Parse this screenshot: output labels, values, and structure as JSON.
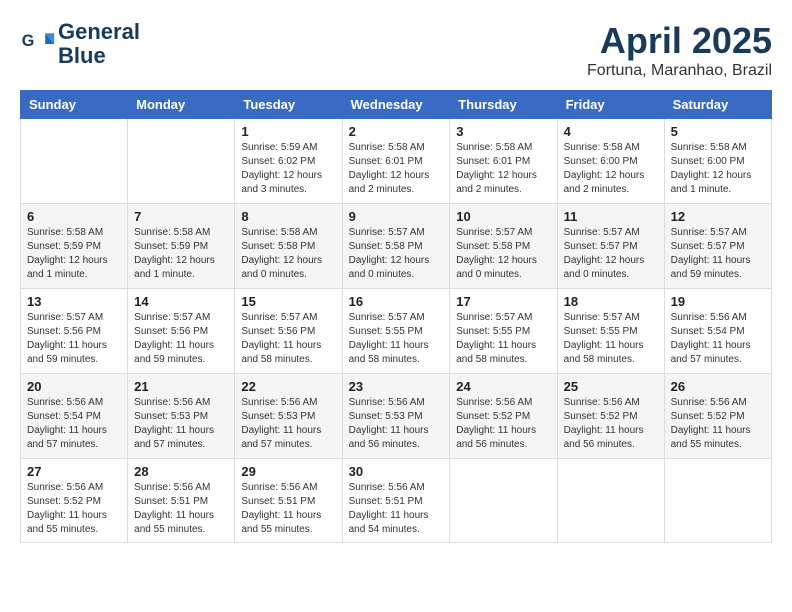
{
  "header": {
    "logo_line1": "General",
    "logo_line2": "Blue",
    "month_year": "April 2025",
    "location": "Fortuna, Maranhao, Brazil"
  },
  "days_of_week": [
    "Sunday",
    "Monday",
    "Tuesday",
    "Wednesday",
    "Thursday",
    "Friday",
    "Saturday"
  ],
  "weeks": [
    [
      {
        "day": "",
        "info": ""
      },
      {
        "day": "",
        "info": ""
      },
      {
        "day": "1",
        "info": "Sunrise: 5:59 AM\nSunset: 6:02 PM\nDaylight: 12 hours\nand 3 minutes."
      },
      {
        "day": "2",
        "info": "Sunrise: 5:58 AM\nSunset: 6:01 PM\nDaylight: 12 hours\nand 2 minutes."
      },
      {
        "day": "3",
        "info": "Sunrise: 5:58 AM\nSunset: 6:01 PM\nDaylight: 12 hours\nand 2 minutes."
      },
      {
        "day": "4",
        "info": "Sunrise: 5:58 AM\nSunset: 6:00 PM\nDaylight: 12 hours\nand 2 minutes."
      },
      {
        "day": "5",
        "info": "Sunrise: 5:58 AM\nSunset: 6:00 PM\nDaylight: 12 hours\nand 1 minute."
      }
    ],
    [
      {
        "day": "6",
        "info": "Sunrise: 5:58 AM\nSunset: 5:59 PM\nDaylight: 12 hours\nand 1 minute."
      },
      {
        "day": "7",
        "info": "Sunrise: 5:58 AM\nSunset: 5:59 PM\nDaylight: 12 hours\nand 1 minute."
      },
      {
        "day": "8",
        "info": "Sunrise: 5:58 AM\nSunset: 5:58 PM\nDaylight: 12 hours\nand 0 minutes."
      },
      {
        "day": "9",
        "info": "Sunrise: 5:57 AM\nSunset: 5:58 PM\nDaylight: 12 hours\nand 0 minutes."
      },
      {
        "day": "10",
        "info": "Sunrise: 5:57 AM\nSunset: 5:58 PM\nDaylight: 12 hours\nand 0 minutes."
      },
      {
        "day": "11",
        "info": "Sunrise: 5:57 AM\nSunset: 5:57 PM\nDaylight: 12 hours\nand 0 minutes."
      },
      {
        "day": "12",
        "info": "Sunrise: 5:57 AM\nSunset: 5:57 PM\nDaylight: 11 hours\nand 59 minutes."
      }
    ],
    [
      {
        "day": "13",
        "info": "Sunrise: 5:57 AM\nSunset: 5:56 PM\nDaylight: 11 hours\nand 59 minutes."
      },
      {
        "day": "14",
        "info": "Sunrise: 5:57 AM\nSunset: 5:56 PM\nDaylight: 11 hours\nand 59 minutes."
      },
      {
        "day": "15",
        "info": "Sunrise: 5:57 AM\nSunset: 5:56 PM\nDaylight: 11 hours\nand 58 minutes."
      },
      {
        "day": "16",
        "info": "Sunrise: 5:57 AM\nSunset: 5:55 PM\nDaylight: 11 hours\nand 58 minutes."
      },
      {
        "day": "17",
        "info": "Sunrise: 5:57 AM\nSunset: 5:55 PM\nDaylight: 11 hours\nand 58 minutes."
      },
      {
        "day": "18",
        "info": "Sunrise: 5:57 AM\nSunset: 5:55 PM\nDaylight: 11 hours\nand 58 minutes."
      },
      {
        "day": "19",
        "info": "Sunrise: 5:56 AM\nSunset: 5:54 PM\nDaylight: 11 hours\nand 57 minutes."
      }
    ],
    [
      {
        "day": "20",
        "info": "Sunrise: 5:56 AM\nSunset: 5:54 PM\nDaylight: 11 hours\nand 57 minutes."
      },
      {
        "day": "21",
        "info": "Sunrise: 5:56 AM\nSunset: 5:53 PM\nDaylight: 11 hours\nand 57 minutes."
      },
      {
        "day": "22",
        "info": "Sunrise: 5:56 AM\nSunset: 5:53 PM\nDaylight: 11 hours\nand 57 minutes."
      },
      {
        "day": "23",
        "info": "Sunrise: 5:56 AM\nSunset: 5:53 PM\nDaylight: 11 hours\nand 56 minutes."
      },
      {
        "day": "24",
        "info": "Sunrise: 5:56 AM\nSunset: 5:52 PM\nDaylight: 11 hours\nand 56 minutes."
      },
      {
        "day": "25",
        "info": "Sunrise: 5:56 AM\nSunset: 5:52 PM\nDaylight: 11 hours\nand 56 minutes."
      },
      {
        "day": "26",
        "info": "Sunrise: 5:56 AM\nSunset: 5:52 PM\nDaylight: 11 hours\nand 55 minutes."
      }
    ],
    [
      {
        "day": "27",
        "info": "Sunrise: 5:56 AM\nSunset: 5:52 PM\nDaylight: 11 hours\nand 55 minutes."
      },
      {
        "day": "28",
        "info": "Sunrise: 5:56 AM\nSunset: 5:51 PM\nDaylight: 11 hours\nand 55 minutes."
      },
      {
        "day": "29",
        "info": "Sunrise: 5:56 AM\nSunset: 5:51 PM\nDaylight: 11 hours\nand 55 minutes."
      },
      {
        "day": "30",
        "info": "Sunrise: 5:56 AM\nSunset: 5:51 PM\nDaylight: 11 hours\nand 54 minutes."
      },
      {
        "day": "",
        "info": ""
      },
      {
        "day": "",
        "info": ""
      },
      {
        "day": "",
        "info": ""
      }
    ]
  ]
}
